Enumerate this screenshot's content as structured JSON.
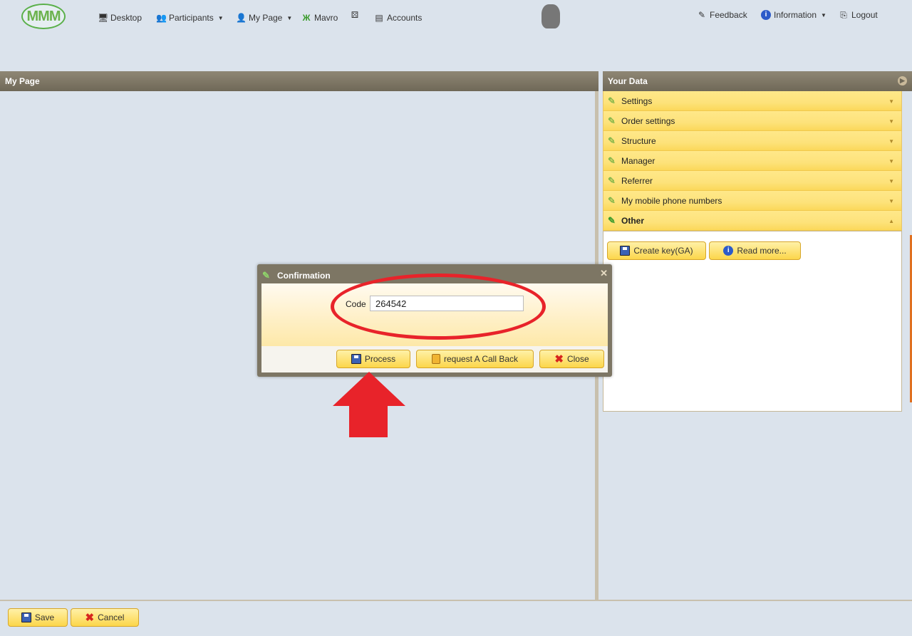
{
  "nav": {
    "logo_text": "MMM",
    "items": [
      {
        "label": "Desktop",
        "icon": "desktop-icon"
      },
      {
        "label": "Participants",
        "icon": "participants-icon",
        "dropdown": true
      },
      {
        "label": "My Page",
        "icon": "user-icon",
        "dropdown": true
      },
      {
        "label": "Mavro",
        "icon": "mavro-icon"
      },
      {
        "label": "",
        "icon": "dice-icon"
      },
      {
        "label": "Accounts",
        "icon": "accounts-icon"
      }
    ],
    "right_items": [
      {
        "label": "Feedback",
        "icon": "feedback-icon"
      },
      {
        "label": "Information",
        "icon": "info-icon",
        "dropdown": true
      },
      {
        "label": "Logout",
        "icon": "logout-icon"
      }
    ]
  },
  "left_panel": {
    "title": "My Page"
  },
  "right_panel": {
    "title": "Your Data",
    "accordion": [
      {
        "label": "Settings",
        "open": false
      },
      {
        "label": "Order settings",
        "open": false
      },
      {
        "label": "Structure",
        "open": false
      },
      {
        "label": "Manager",
        "open": false
      },
      {
        "label": "Referrer",
        "open": false
      },
      {
        "label": "My mobile phone numbers",
        "open": false
      },
      {
        "label": "Other",
        "open": true
      }
    ],
    "other_buttons": {
      "create_key": "Create key(GA)",
      "read_more": "Read more..."
    }
  },
  "dialog": {
    "title": "Confirmation",
    "code_label": "Code",
    "code_value": "264542",
    "buttons": {
      "process": "Process",
      "callback": "request A Call Back",
      "close": "Close"
    }
  },
  "footer": {
    "save": "Save",
    "cancel": "Cancel"
  },
  "colors": {
    "annotation_red": "#e8232a",
    "panel_header": "#7d7664",
    "accordion": "#fde27a"
  }
}
